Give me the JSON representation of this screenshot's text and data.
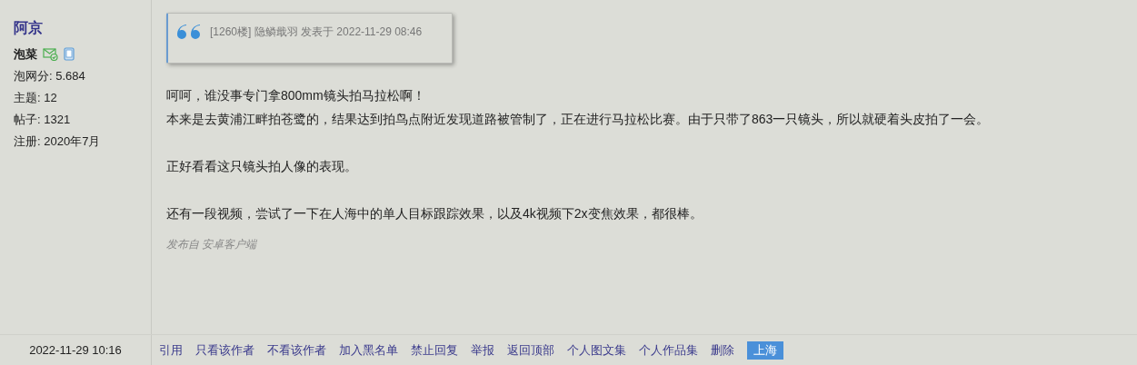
{
  "author": {
    "name": "阿京",
    "rank": "泡菜",
    "stats": [
      "泡网分: 5.684",
      "主题: 12",
      "帖子: 1321",
      "注册: 2020年7月"
    ]
  },
  "quote": {
    "meta": "[1260楼] 隐鳞戢羽 发表于 2022-11-29 08:46"
  },
  "paragraphs": [
    [
      "呵呵，谁没事专门拿800mm镜头拍马拉松啊！",
      "本来是去黄浦江畔拍苍鹭的，结果达到拍鸟点附近发现道路被管制了，正在进行马拉松比赛。由于只带了863一只镜头，所以就硬着头皮拍了一会。"
    ],
    [
      "正好看看这只镜头拍人像的表现。"
    ],
    [
      "还有一段视频，尝试了一下在人海中的单人目标跟踪效果，以及4k视频下2x变焦效果，都很棒。"
    ]
  ],
  "source": "发布自 安卓客户端",
  "post_time": "2022-11-29 10:16",
  "actions": [
    {
      "label": "引用",
      "kind": "link"
    },
    {
      "label": "只看该作者",
      "kind": "link"
    },
    {
      "label": "不看该作者",
      "kind": "link"
    },
    {
      "label": "加入黑名单",
      "kind": "link"
    },
    {
      "label": "禁止回复",
      "kind": "link"
    },
    {
      "label": "举报",
      "kind": "link"
    },
    {
      "label": "返回顶部",
      "kind": "link"
    },
    {
      "label": "个人图文集",
      "kind": "link"
    },
    {
      "label": "个人作品集",
      "kind": "link"
    },
    {
      "label": "删除",
      "kind": "link"
    },
    {
      "label": "上海",
      "kind": "location"
    }
  ]
}
